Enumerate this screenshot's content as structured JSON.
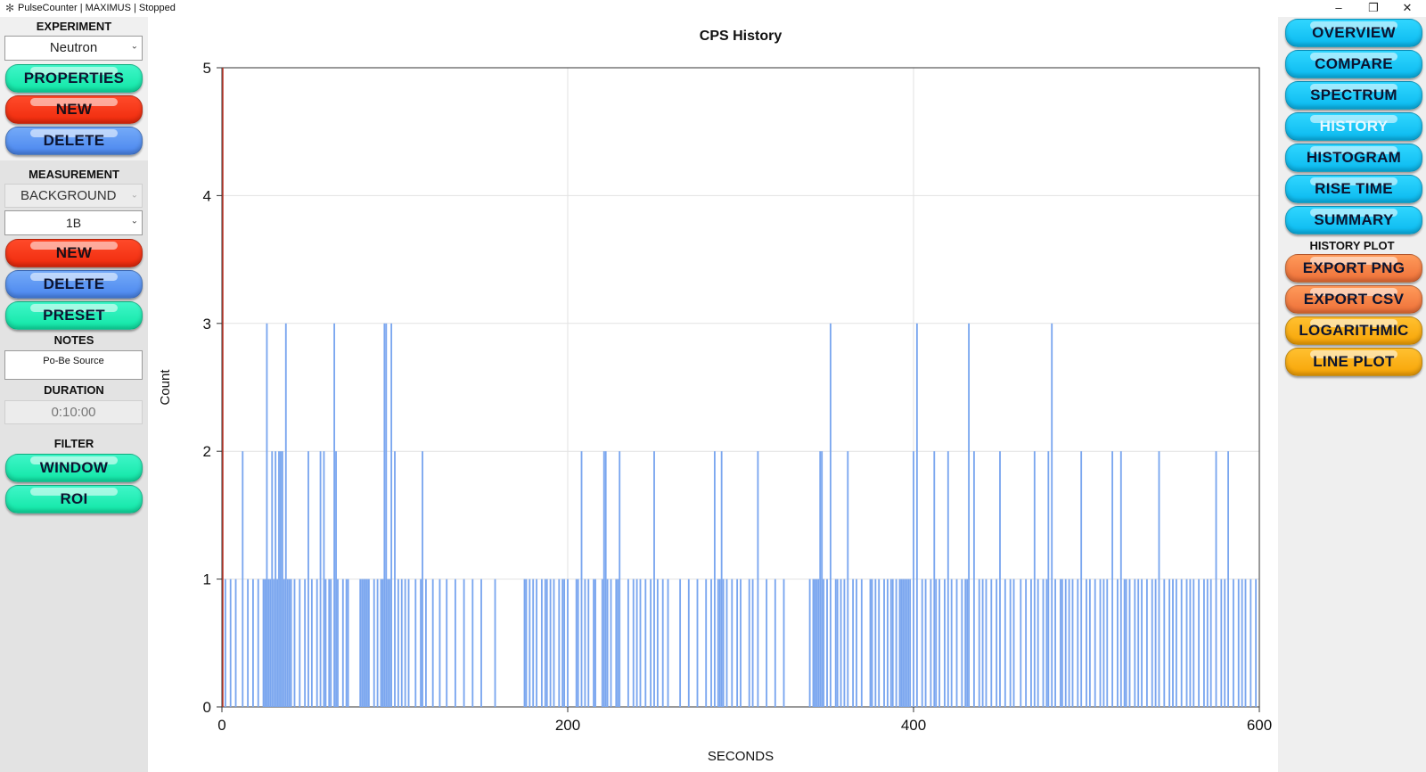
{
  "window": {
    "title": "PulseCounter | MAXIMUS | Stopped",
    "minimize": "–",
    "restore": "❐",
    "close": "✕"
  },
  "left": {
    "experiment_label": "EXPERIMENT",
    "experiment_value": "Neutron",
    "properties_btn": "PROPERTIES",
    "new_btn": "NEW",
    "delete_btn": "DELETE",
    "measurement_label": "MEASUREMENT",
    "measurement_type": "BACKGROUND",
    "measurement_value": "1B",
    "m_new_btn": "NEW",
    "m_delete_btn": "DELETE",
    "preset_btn": "PRESET",
    "notes_label": "NOTES",
    "notes_value": "Po-Be Source",
    "duration_label": "DURATION",
    "duration_value": "0:10:00",
    "filter_label": "FILTER",
    "window_btn": "WINDOW",
    "roi_btn": "ROI"
  },
  "right": {
    "overview_btn": "OVERVIEW",
    "compare_btn": "COMPARE",
    "spectrum_btn": "SPECTRUM",
    "history_btn": "HISTORY",
    "histogram_btn": "HISTOGRAM",
    "risetime_btn": "RISE TIME",
    "summary_btn": "SUMMARY",
    "history_plot_label": "HISTORY PLOT",
    "export_png_btn": "EXPORT PNG",
    "export_csv_btn": "EXPORT CSV",
    "logarithmic_btn": "LOGARITHMIC",
    "lineplot_btn": "LINE PLOT"
  },
  "colors": {
    "bar": "#7aa6ef",
    "cursor": "#c0392b",
    "grid": "#e2e2e2"
  },
  "chart_data": {
    "type": "bar",
    "title": "CPS History",
    "xlabel": "SECONDS",
    "ylabel": "Count",
    "xlim": [
      0,
      600
    ],
    "ylim": [
      0,
      5
    ],
    "xticks": [
      0,
      200,
      400,
      600
    ],
    "yticks": [
      0,
      1,
      2,
      3,
      4,
      5
    ],
    "grid": true,
    "cursor_x": 0,
    "x": [
      2,
      5,
      8,
      12,
      15,
      18,
      21,
      24,
      25,
      26,
      27,
      28,
      29,
      30,
      31,
      32,
      33,
      34,
      35,
      36,
      37,
      38,
      39,
      40,
      42,
      45,
      48,
      50,
      52,
      55,
      57,
      59,
      60,
      62,
      63,
      65,
      66,
      67,
      70,
      72,
      73,
      80,
      81,
      82,
      83,
      84,
      85,
      88,
      90,
      92,
      93,
      94,
      95,
      96,
      97,
      98,
      100,
      102,
      104,
      106,
      108,
      112,
      115,
      116,
      118,
      122,
      126,
      130,
      135,
      140,
      145,
      150,
      158,
      175,
      176,
      178,
      180,
      182,
      185,
      187,
      188,
      190,
      192,
      195,
      197,
      198,
      200,
      205,
      206,
      208,
      210,
      212,
      215,
      216,
      220,
      221,
      222,
      223,
      225,
      228,
      229,
      230,
      235,
      238,
      240,
      242,
      245,
      248,
      250,
      252,
      255,
      258,
      265,
      270,
      275,
      280,
      283,
      285,
      287,
      288,
      289,
      290,
      292,
      295,
      298,
      300,
      305,
      307,
      310,
      315,
      320,
      325,
      340,
      342,
      343,
      344,
      345,
      346,
      347,
      348,
      350,
      352,
      355,
      356,
      358,
      360,
      362,
      365,
      367,
      370,
      375,
      376,
      378,
      380,
      383,
      385,
      387,
      388,
      390,
      392,
      393,
      394,
      395,
      396,
      397,
      398,
      400,
      402,
      405,
      407,
      410,
      412,
      413,
      415,
      418,
      420,
      422,
      425,
      428,
      430,
      431,
      432,
      435,
      438,
      440,
      442,
      445,
      448,
      450,
      453,
      456,
      458,
      462,
      465,
      468,
      470,
      472,
      475,
      477,
      478,
      480,
      482,
      485,
      486,
      488,
      490,
      492,
      495,
      497,
      500,
      502,
      505,
      508,
      510,
      512,
      515,
      518,
      520,
      522,
      523,
      525,
      528,
      530,
      532,
      535,
      538,
      540,
      542,
      545,
      548,
      550,
      552,
      555,
      558,
      560,
      562,
      565,
      568,
      570,
      572,
      575,
      578,
      580,
      582,
      585,
      588,
      590,
      592,
      595,
      598
    ],
    "values": [
      1,
      1,
      1,
      2,
      1,
      1,
      1,
      1,
      1,
      3,
      1,
      1,
      2,
      1,
      2,
      1,
      2,
      2,
      2,
      1,
      3,
      1,
      1,
      1,
      1,
      1,
      1,
      2,
      1,
      1,
      2,
      2,
      1,
      1,
      1,
      3,
      2,
      1,
      1,
      1,
      1,
      1,
      1,
      1,
      1,
      1,
      1,
      1,
      1,
      1,
      1,
      3,
      3,
      1,
      1,
      3,
      2,
      1,
      1,
      1,
      1,
      1,
      1,
      2,
      1,
      1,
      1,
      1,
      1,
      1,
      1,
      1,
      1,
      1,
      1,
      1,
      1,
      1,
      1,
      1,
      1,
      1,
      1,
      1,
      1,
      1,
      1,
      1,
      1,
      2,
      1,
      1,
      1,
      1,
      1,
      2,
      2,
      1,
      1,
      1,
      1,
      2,
      1,
      1,
      1,
      1,
      1,
      1,
      2,
      1,
      1,
      1,
      1,
      1,
      1,
      1,
      1,
      2,
      1,
      1,
      2,
      1,
      1,
      1,
      1,
      1,
      1,
      1,
      2,
      1,
      1,
      1,
      1,
      1,
      1,
      1,
      1,
      2,
      2,
      1,
      1,
      3,
      1,
      1,
      1,
      1,
      2,
      1,
      1,
      1,
      1,
      1,
      1,
      1,
      1,
      1,
      1,
      1,
      1,
      1,
      1,
      1,
      1,
      1,
      1,
      1,
      2,
      3,
      1,
      1,
      1,
      2,
      1,
      1,
      1,
      2,
      1,
      1,
      1,
      1,
      1,
      3,
      2,
      1,
      1,
      1,
      1,
      1,
      2,
      1,
      1,
      1,
      1,
      1,
      1,
      2,
      1,
      1,
      1,
      2,
      3,
      1,
      1,
      1,
      1,
      1,
      1,
      1,
      2,
      1,
      1,
      1,
      1,
      1,
      1,
      2,
      1,
      2,
      1,
      1,
      1,
      1,
      1,
      1,
      1,
      1,
      1,
      2,
      1,
      1,
      1,
      1,
      1,
      1,
      1,
      1,
      1,
      1,
      1,
      1,
      2,
      1,
      1,
      2,
      1,
      1,
      1,
      1,
      1,
      1,
      1,
      1
    ]
  }
}
